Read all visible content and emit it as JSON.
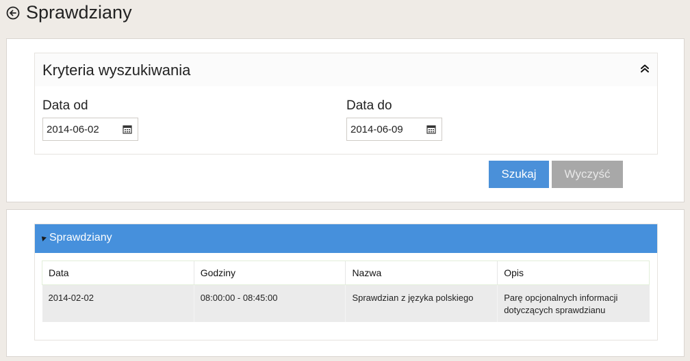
{
  "header": {
    "title": "Sprawdziany",
    "back_icon": "arrow-left-circle-icon"
  },
  "search": {
    "title": "Kryteria wyszukiwania",
    "collapse_icon": "double-chevron-up-icon",
    "date_from_label": "Data od",
    "date_from_value": "2014-06-02",
    "date_to_label": "Data do",
    "date_to_value": "2014-06-09",
    "calendar_icon": "calendar-icon",
    "search_button": "Szukaj",
    "clear_button": "Wyczyść"
  },
  "results": {
    "title": "Sprawdziany",
    "columns": [
      "Data",
      "Godziny",
      "Nazwa",
      "Opis"
    ],
    "rows": [
      {
        "data": "2014-02-02",
        "godziny": "08:00:00 - 08:45:00",
        "nazwa": "Sprawdzian z języka polskiego",
        "opis": "Parę opcjonalnych informacji dotyczących sprawdzianu"
      }
    ]
  },
  "colors": {
    "accent": "#4690dc",
    "button_primary": "#4a90d9",
    "button_disabled": "#a8a8a8",
    "background": "#efebe6"
  }
}
